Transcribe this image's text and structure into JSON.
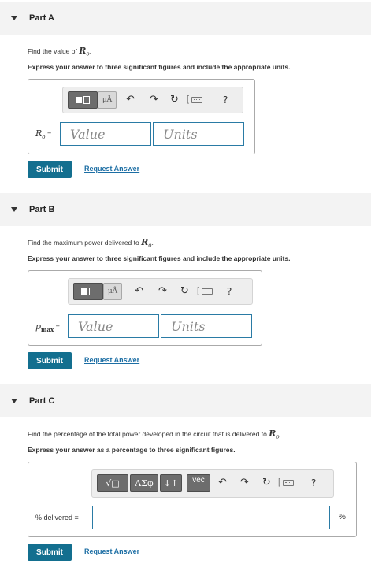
{
  "partA": {
    "title": "Part A",
    "prompt_text": "Find the value of ",
    "prompt_var": "R",
    "prompt_sub": "o",
    "prompt_end": ".",
    "instructions": "Express your answer to three significant figures and include the appropriate units.",
    "toolbar": {
      "unit_btn": "μÅ",
      "help": "?"
    },
    "field_label_var": "R",
    "field_label_sub": "o",
    "field_label_eq": " =",
    "value_placeholder": "Value",
    "units_placeholder": "Units",
    "submit": "Submit",
    "request": "Request Answer"
  },
  "partB": {
    "title": "Part B",
    "prompt_text": "Find the maximum power delivered to ",
    "prompt_var": "R",
    "prompt_sub": "o",
    "prompt_end": ".",
    "instructions": "Express your answer to three significant figures and include the appropriate units.",
    "toolbar": {
      "unit_btn": "μÅ",
      "help": "?"
    },
    "field_label_var": "p",
    "field_label_sub": "max",
    "field_label_eq": " =",
    "value_placeholder": "Value",
    "units_placeholder": "Units",
    "submit": "Submit",
    "request": "Request Answer"
  },
  "partC": {
    "title": "Part C",
    "prompt_text": "Find the percentage of the total power developed in the circuit that is delivered to ",
    "prompt_var": "R",
    "prompt_sub": "o",
    "prompt_end": ".",
    "instructions": "Express your answer as a percentage to three significant figures.",
    "toolbar": {
      "sqrt_btn": "√□",
      "greek_btn": "ΑΣφ",
      "arrows_btn": "↓↑",
      "vec_btn": "vec",
      "help": "?"
    },
    "field_label": "% delivered =",
    "unit_suffix": "%",
    "submit": "Submit",
    "request": "Request Answer"
  },
  "icons": {
    "undo": "undo-icon",
    "redo": "redo-icon",
    "reset": "reset-icon",
    "keyboard": "keyboard-icon",
    "templates": "templates-icon"
  }
}
